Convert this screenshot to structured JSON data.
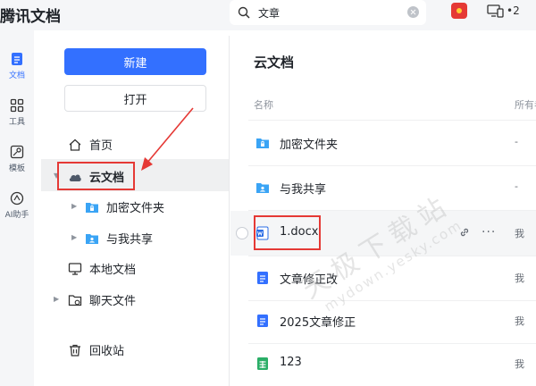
{
  "app": {
    "title": "腾讯文档"
  },
  "search": {
    "value": "文章"
  },
  "topbar": {
    "device_count": "•2"
  },
  "rail": [
    {
      "label": "文档",
      "icon": "doc-icon"
    },
    {
      "label": "工具",
      "icon": "grid-icon"
    },
    {
      "label": "模板",
      "icon": "template-icon"
    },
    {
      "label": "AI助手",
      "icon": "ai-icon"
    }
  ],
  "nav": {
    "new_label": "新建",
    "open_label": "打开",
    "items": [
      {
        "label": "首页",
        "icon": "home-icon"
      },
      {
        "label": "云文档",
        "icon": "cloud-icon"
      },
      {
        "label": "加密文件夹",
        "icon": "lock-folder-icon"
      },
      {
        "label": "与我共享",
        "icon": "shared-folder-icon"
      },
      {
        "label": "本地文档",
        "icon": "monitor-icon"
      },
      {
        "label": "聊天文件",
        "icon": "chat-folder-icon"
      },
      {
        "label": "回收站",
        "icon": "trash-icon"
      }
    ]
  },
  "main": {
    "title": "云文档",
    "columns": {
      "name": "名称",
      "owner": "所有者"
    },
    "rows": [
      {
        "name": "加密文件夹",
        "owner": "-",
        "type": "lock-folder"
      },
      {
        "name": "与我共享",
        "owner": "-",
        "type": "shared-folder"
      },
      {
        "name": "1.docx",
        "owner": "我",
        "type": "word"
      },
      {
        "name": "文章修正改",
        "owner": "我",
        "type": "doc"
      },
      {
        "name": "2025文章修正",
        "owner": "我",
        "type": "doc"
      },
      {
        "name": "123",
        "owner": "我",
        "type": "sheet"
      }
    ]
  },
  "watermark": {
    "line1": "天极下载站",
    "line2": "mydown.yesky.com"
  },
  "colors": {
    "accent": "#3370ff",
    "highlight": "#e53935",
    "folder": "#3aa4f5",
    "sheet": "#2aae67"
  }
}
